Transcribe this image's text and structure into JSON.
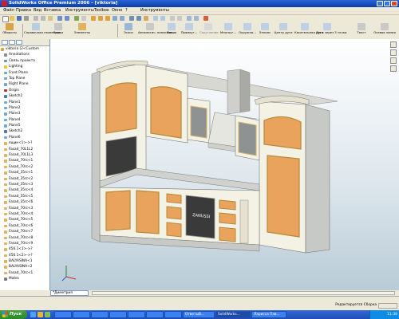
{
  "window": {
    "title": "SolidWorks Office Premium 2006 - [viktoria]"
  },
  "menubar": {
    "items": [
      "Файл",
      "Правка",
      "Вид",
      "Вставка",
      "Инструменты",
      "Toolbox",
      "Окно",
      "?",
      "Инструменты"
    ]
  },
  "commandmanager": {
    "buttons": [
      "Обороты",
      "Справочная геометрия",
      "Блоки",
      "Элементы",
      "Эскиз",
      "Автоматич. нанесени...",
      "Линия",
      "Прямоуг...",
      "Скругление",
      "Многоуг...",
      "Окружно...",
      "Эллипс",
      "Центр дуги",
      "Касательная дуга",
      "Дуга через 3 точки",
      "Текст",
      "Осевая линия"
    ]
  },
  "feature_tree": {
    "items": [
      {
        "label": "viktoria (2<Custom",
        "icon": "part-icon"
      },
      {
        "label": "Annotations",
        "icon": "annotations-icon"
      },
      {
        "label": "Связь проекта",
        "icon": "design-binder-icon"
      },
      {
        "label": "Lighting",
        "icon": "lighting-icon"
      },
      {
        "label": "Front Plane",
        "icon": "plane-icon"
      },
      {
        "label": "Top Plane",
        "icon": "plane-icon"
      },
      {
        "label": "Right Plane",
        "icon": "plane-icon"
      },
      {
        "label": "Origin",
        "icon": "origin-icon"
      },
      {
        "label": "Sketch1",
        "icon": "sketch-icon"
      },
      {
        "label": "Plane1",
        "icon": "plane-icon"
      },
      {
        "label": "Plane2",
        "icon": "plane-icon"
      },
      {
        "label": "Plane3",
        "icon": "plane-icon"
      },
      {
        "label": "Plane4",
        "icon": "plane-icon"
      },
      {
        "label": "Plane5",
        "icon": "plane-icon"
      },
      {
        "label": "Sketch2",
        "icon": "sketch-icon"
      },
      {
        "label": "Plane6",
        "icon": "plane-icon"
      },
      {
        "label": "ящик<1>->?",
        "icon": "component-icon"
      },
      {
        "label": "Fasad_70L1L2",
        "icon": "component-icon"
      },
      {
        "label": "Fasad_70L1L3",
        "icon": "component-icon"
      },
      {
        "label": "Fasad_70rc<1",
        "icon": "component-icon"
      },
      {
        "label": "Fasad_70rc<2",
        "icon": "component-icon"
      },
      {
        "label": "Fasad_35rc<1",
        "icon": "component-icon"
      },
      {
        "label": "Fasad_35rc<2",
        "icon": "component-icon"
      },
      {
        "label": "Fasad_35rc<3",
        "icon": "component-icon"
      },
      {
        "label": "Fasad_35rc<4",
        "icon": "component-icon"
      },
      {
        "label": "Fasad_35rc<5",
        "icon": "component-icon"
      },
      {
        "label": "Fasad_35rc<6",
        "icon": "component-icon"
      },
      {
        "label": "Fasad_70rc<3",
        "icon": "component-icon"
      },
      {
        "label": "Fasad_70rc<4",
        "icon": "component-icon"
      },
      {
        "label": "Fasad_70rc<5",
        "icon": "component-icon"
      },
      {
        "label": "Fasad_70rc<6",
        "icon": "component-icon"
      },
      {
        "label": "Fasad_70rc<7",
        "icon": "component-icon"
      },
      {
        "label": "Fasad_70rc<8",
        "icon": "component-icon"
      },
      {
        "label": "Fasad_70rc<9",
        "icon": "component-icon"
      },
      {
        "label": "456.1<1>->?",
        "icon": "component-icon"
      },
      {
        "label": "456.1<2>->?",
        "icon": "component-icon"
      },
      {
        "label": "BALYASINA<1",
        "icon": "component-icon"
      },
      {
        "label": "BALYASINA<2",
        "icon": "component-icon"
      },
      {
        "label": "Fasad_70rc<1",
        "icon": "component-icon"
      },
      {
        "label": "Mates",
        "icon": "mates-icon"
      }
    ]
  },
  "viewport": {
    "view_orientation": "*Диметрия",
    "appliance_label": "ZANUSSI"
  },
  "statusbar": {
    "message": "",
    "mode": "Редактируется Сборка"
  },
  "taskbar": {
    "start_label": "Пуск",
    "tasks": [
      "",
      "",
      "",
      "",
      "",
      "",
      "",
      "ОтветыВ...",
      "SolidWorks...",
      "Ларисса Пав..."
    ],
    "clock": "11:38"
  },
  "colors": {
    "title_blue": "#0a3fa8",
    "taskbar_blue": "#2456c6",
    "cabinet_front": "#f4f2e4",
    "cabinet_side": "#c7c9c6",
    "panel_orange": "#e9a35c",
    "panel_dark": "#3a3a3a",
    "glass_gray": "#8f9293",
    "gold_frame": "#d4b468"
  }
}
